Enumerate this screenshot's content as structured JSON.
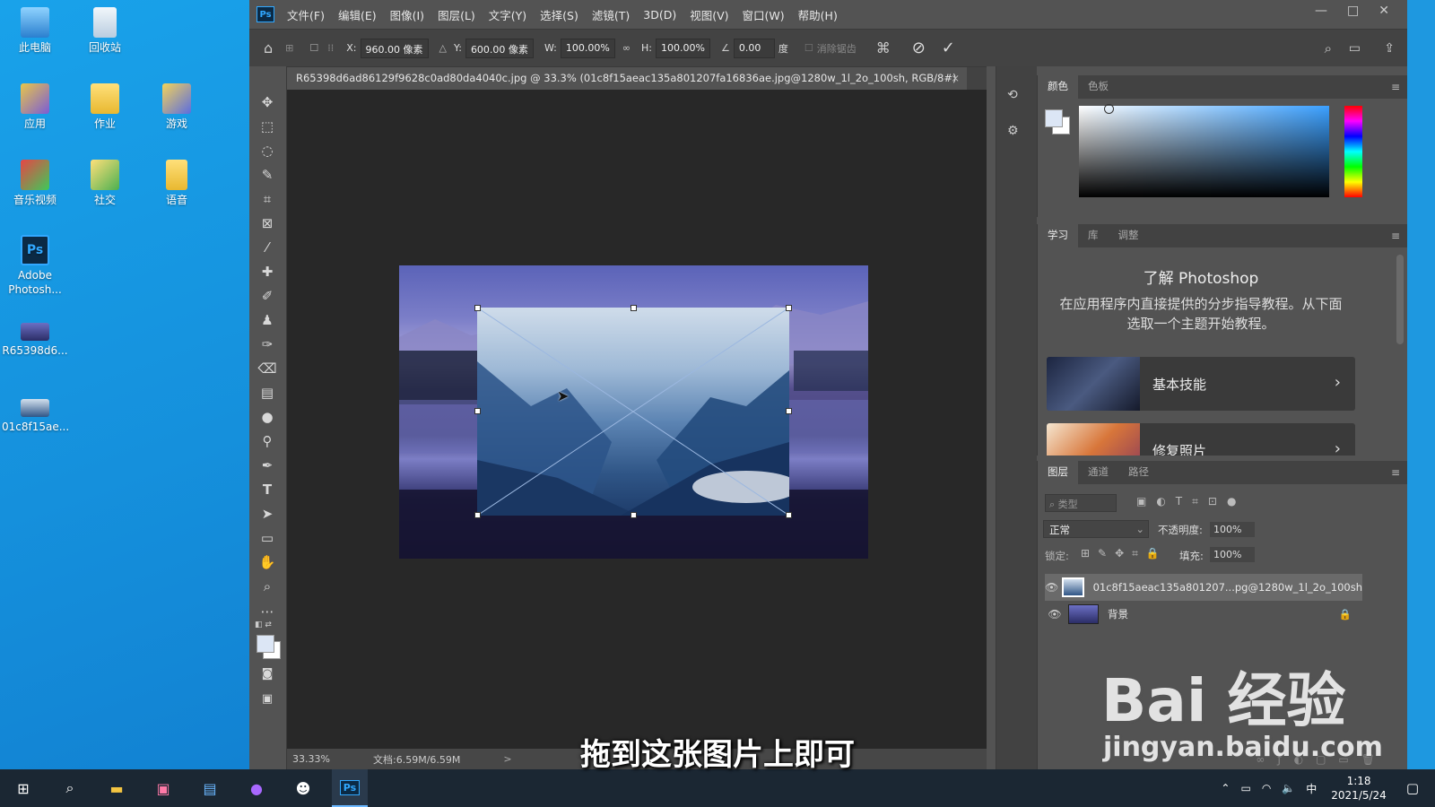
{
  "desktop": {
    "icons": [
      {
        "label": "此电脑"
      },
      {
        "label": "回收站"
      },
      {
        "label": "应用"
      },
      {
        "label": "作业"
      },
      {
        "label": "游戏"
      },
      {
        "label": "音乐视频"
      },
      {
        "label": "社交"
      },
      {
        "label": "语音"
      },
      {
        "label": "Adobe Photosh..."
      },
      {
        "label": "R65398d6..."
      },
      {
        "label": "01c8f15ae..."
      }
    ]
  },
  "app": {
    "logo": "Ps",
    "menus": [
      "文件(F)",
      "编辑(E)",
      "图像(I)",
      "图层(L)",
      "文字(Y)",
      "选择(S)",
      "滤镜(T)",
      "3D(D)",
      "视图(V)",
      "窗口(W)",
      "帮助(H)"
    ],
    "window_controls": {
      "minimize": "—",
      "maximize": "□",
      "close": "✕"
    }
  },
  "options": {
    "x_label": "X:",
    "x_value": "960.00 像素",
    "y_label": "Y:",
    "y_value": "600.00 像素",
    "w_label": "W:",
    "w_value": "100.00%",
    "h_label": "H:",
    "h_value": "100.00%",
    "angle_value": "0.00",
    "angle_unit": "度",
    "antialias_label": "消除锯齿"
  },
  "document": {
    "tab_title": "R65398d6ad86129f9628c0ad80da4040c.jpg @ 33.3% (01c8f15aeac135a801207fa16836ae.jpg@1280w_1l_2o_100sh, RGB/8#)",
    "close": "×",
    "zoom": "33.33%",
    "doc_size": "文档:6.59M/6.59M",
    "status_arrow": ">"
  },
  "color_panel": {
    "tabs": [
      "颜色",
      "色板"
    ],
    "accent": "#3ba0ff"
  },
  "learn_panel": {
    "tabs": [
      "学习",
      "库",
      "调整"
    ],
    "heading": "了解 Photoshop",
    "description": "在应用程序内直接提供的分步指导教程。从下面选取一个主题开始教程。",
    "cards": [
      {
        "title": "基本技能"
      },
      {
        "title": "修复照片"
      }
    ]
  },
  "layers_panel": {
    "tabs": [
      "图层",
      "通道",
      "路径"
    ],
    "filter_placeholder": "类型",
    "blend_mode": "正常",
    "opacity_label": "不透明度:",
    "opacity_value": "100%",
    "lock_label": "锁定:",
    "fill_label": "填充:",
    "fill_value": "100%",
    "layers": [
      {
        "name": "01c8f15aeac135a801207...pg@1280w_1l_2o_100sh"
      },
      {
        "name": "背景"
      }
    ]
  },
  "taskbar": {
    "time": "1:18",
    "date": "2021/5/24",
    "ime": "中"
  },
  "overlay": {
    "subtitle": "拖到这张图片上即可",
    "watermark_brand": "Bai 经验",
    "watermark_url": "jingyan.baidu.com"
  }
}
